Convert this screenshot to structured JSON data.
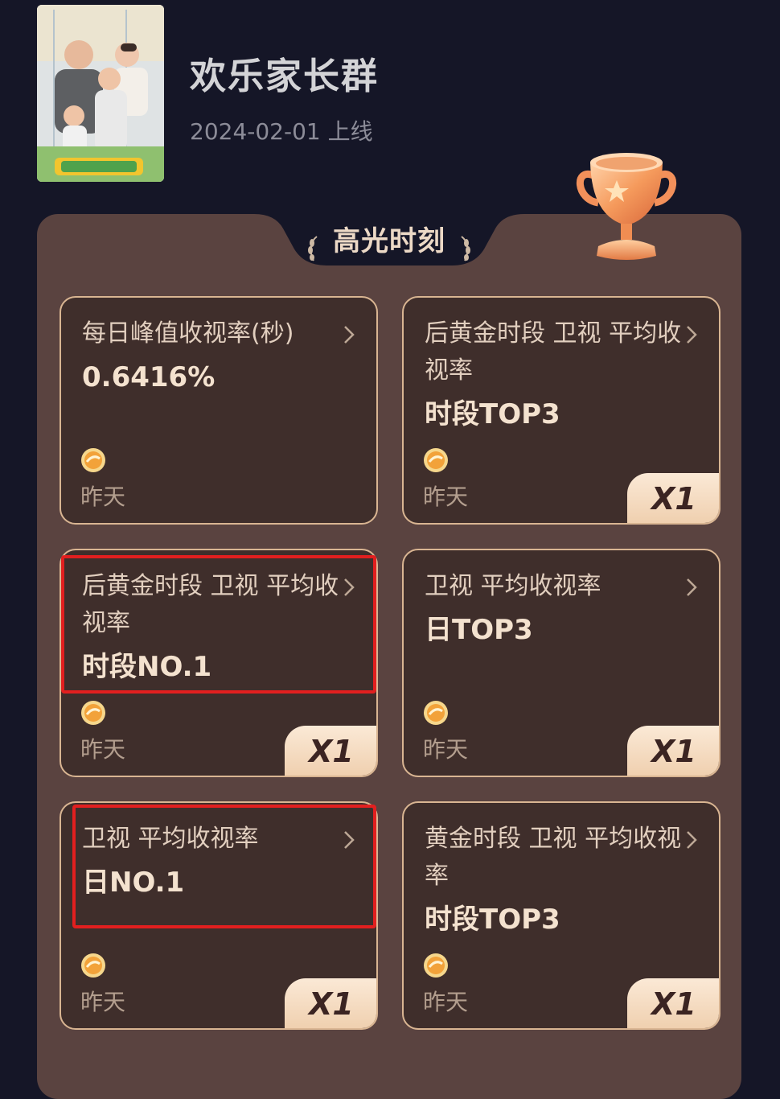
{
  "show": {
    "title": "欢乐家长群",
    "release_date": "2024-02-01 上线"
  },
  "panel": {
    "section_title": "高光时刻"
  },
  "cards": [
    {
      "label": "每日峰值收视率(秒)",
      "value": "0.6416%",
      "time": "昨天",
      "badge": null,
      "highlighted": false
    },
    {
      "label": "后黄金时段 卫视 平均收视率",
      "value": "时段TOP3",
      "time": "昨天",
      "badge": "X1",
      "highlighted": false
    },
    {
      "label": "后黄金时段 卫视 平均收视率",
      "value": "时段NO.1",
      "time": "昨天",
      "badge": "X1",
      "highlighted": true
    },
    {
      "label": "卫视 平均收视率",
      "value": "日TOP3",
      "time": "昨天",
      "badge": "X1",
      "highlighted": false
    },
    {
      "label": "卫视 平均收视率",
      "value": "日NO.1",
      "time": "昨天",
      "badge": "X1",
      "highlighted": true
    },
    {
      "label": "黄金时段 卫视 平均收视率",
      "value": "时段TOP3",
      "time": "昨天",
      "badge": "X1",
      "highlighted": false
    }
  ],
  "colors": {
    "page_background": "#151627",
    "panel_background": "#5a4340",
    "card_background": "#3f2e2b",
    "card_border": "#d9b592",
    "highlight_border": "#e21f1f",
    "badge_background": "#fbe9d6"
  },
  "icons": {
    "trophy": "trophy-icon",
    "coin": "coin-icon",
    "chevron": "chevron-right-icon",
    "laurel": "laurel-icon"
  }
}
